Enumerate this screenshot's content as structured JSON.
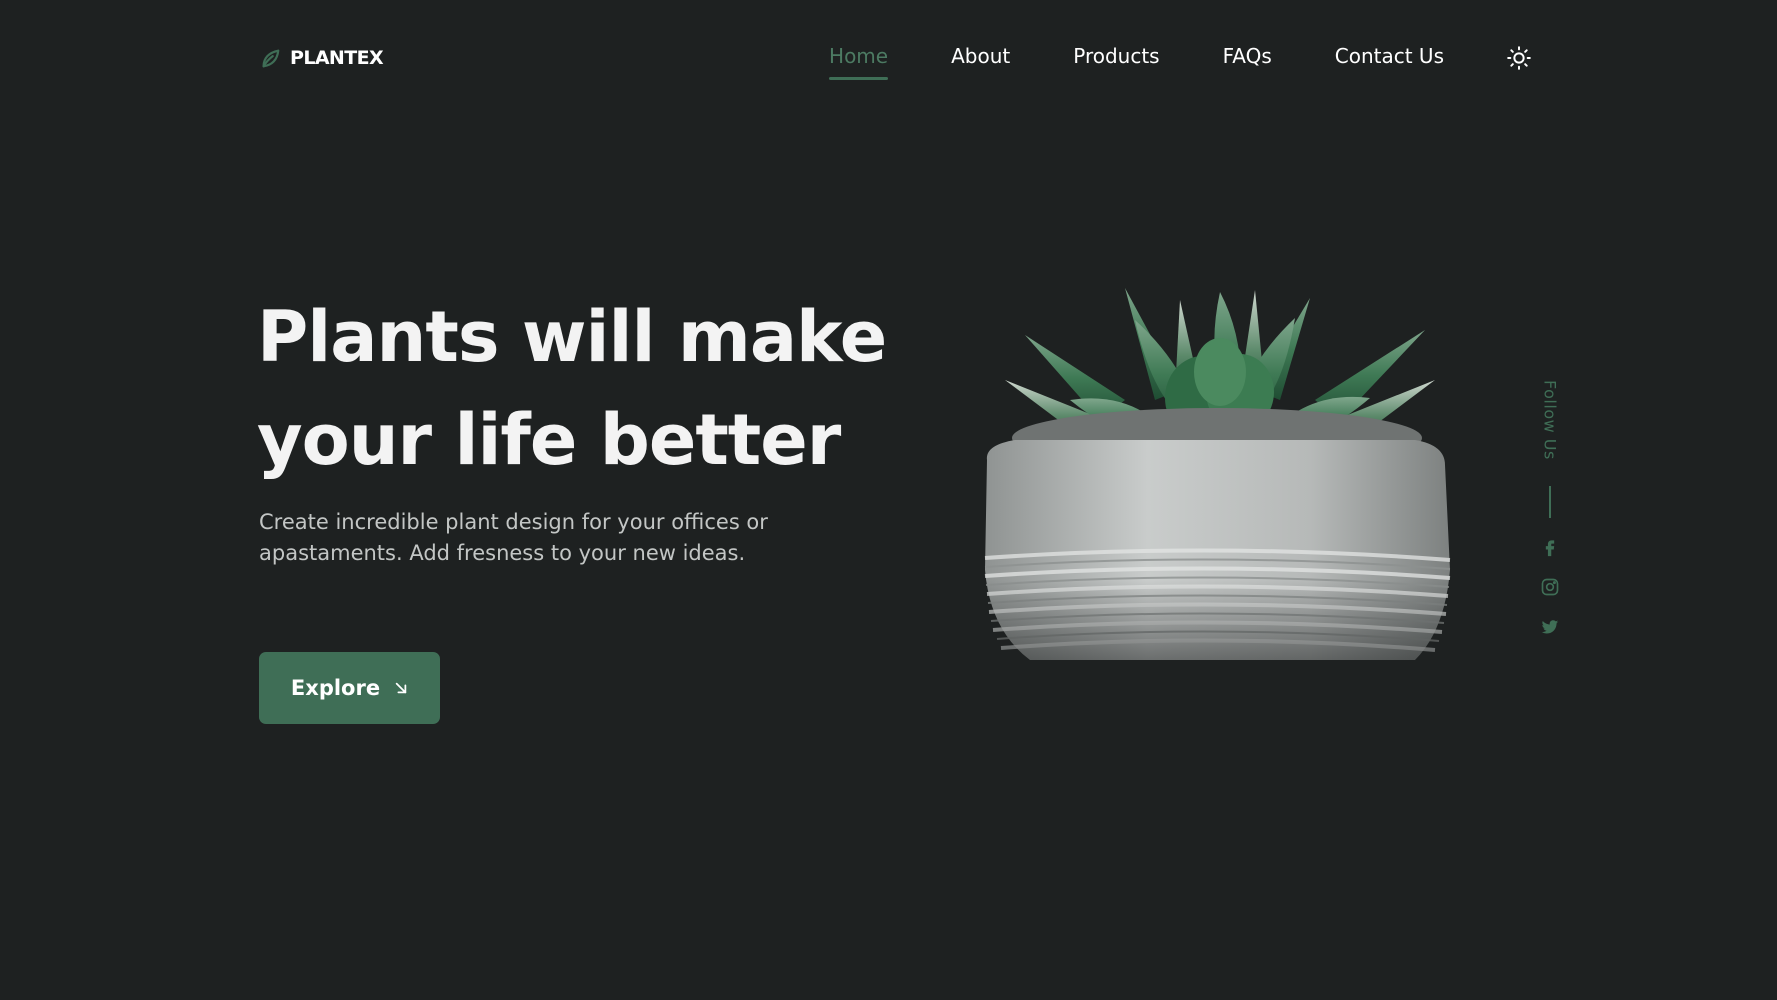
{
  "brand": {
    "name": "PLANTEX",
    "logo_icon": "leaf-icon"
  },
  "nav": {
    "items": [
      {
        "label": "Home",
        "active": true
      },
      {
        "label": "About",
        "active": false
      },
      {
        "label": "Products",
        "active": false
      },
      {
        "label": "FAQs",
        "active": false
      },
      {
        "label": "Contact Us",
        "active": false
      }
    ],
    "theme_toggle_icon": "sun-icon"
  },
  "hero": {
    "title_line1": "Plants will make",
    "title_line2": "your life better",
    "description": "Create incredible plant design for your offices or apastaments. Add fresness to your new ideas.",
    "button_label": "Explore",
    "button_icon": "arrow-down-right-icon",
    "image": "succulent-in-concrete-pot"
  },
  "social": {
    "label": "Follow Us",
    "links": [
      {
        "icon": "facebook-icon"
      },
      {
        "icon": "instagram-icon"
      },
      {
        "icon": "twitter-icon"
      }
    ]
  },
  "colors": {
    "background": "#1e2121",
    "accent": "#3f6e56",
    "text": "#ffffff",
    "muted_text": "#c3c6c5"
  }
}
